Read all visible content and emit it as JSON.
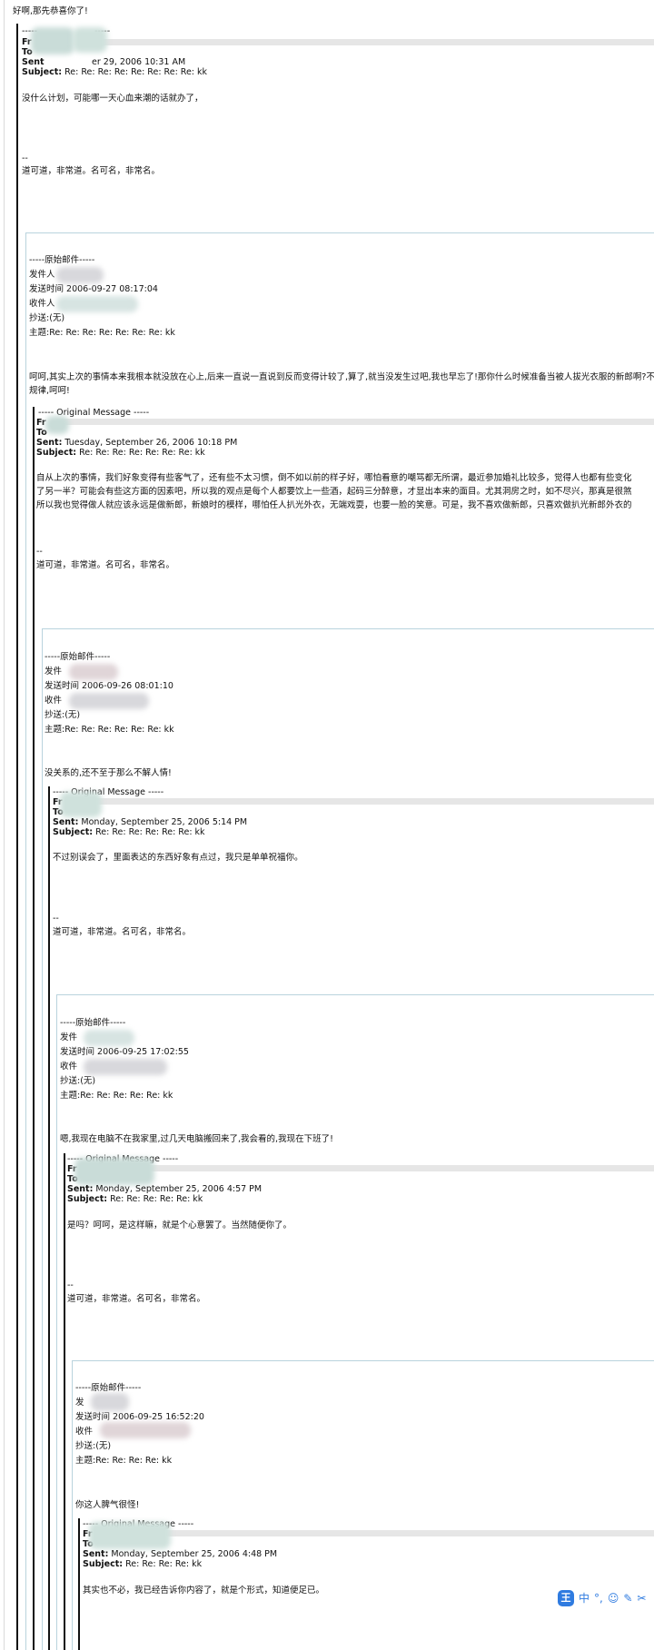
{
  "top_line": "好啊,那先恭喜你了!",
  "signature_dash": "--",
  "signature": "道可道，非常道。名可名，非常名。",
  "l0": {
    "dashes": "-----",
    "from": "Fr",
    "to": "To",
    "sent_label": "Sent",
    "sent_value": "er 29, 2006 10:31 AM",
    "subject_label": "Subject:",
    "subject_value": "Re: Re: Re: Re: Re: Re: Re: Re: kk",
    "body": "没什么计划，可能哪一天心血来潮的话就办了，"
  },
  "c1": {
    "header": "-----原始邮件-----",
    "sender": "发件人",
    "time": "发送时间 2006-09-27 08:17:04",
    "receiver": "收件人",
    "cc": "抄送:(无)",
    "subject": "主题:Re: Re: Re: Re: Re: Re: Re: kk",
    "body_line1": "呵呵,其实上次的事情本来我根本就没放在心上,后来一直说一直说到反而变得计较了,算了,就当没发生过吧,我也早忘了!那你什么时候准备当被人拔光衣服的新郎啊?不喜欢",
    "body_line2": "规律,呵呵!"
  },
  "l1": {
    "header": "----- Original Message -----",
    "from": "Fr",
    "to": "To",
    "sent_label": "Sent:",
    "sent_value": "Tuesday, September 26, 2006 10:18 PM",
    "subject_label": "Subject:",
    "subject_value": "Re: Re: Re: Re: Re: Re: Re: kk",
    "body_line1": "自从上次的事情，我们好象变得有些客气了，还有些不太习惯，倒不如以前的样子好，哪怕看意的嘲骂都无所谓，最近参加婚礼比较多，觉得人也都有些变化",
    "body_line2": "了另一半？可能会有些这方面的因素吧，所以我的观点是每个人都要饮上一些酒，起码三分醉意，才显出本来的面目。尤其洞房之时，如不尽兴，那真是很煞",
    "body_line3": "所以我也觉得做人就应该永远是做新郎，新娘时的模样，哪怕任人扒光外衣，无端戏耍，也要一脸的笑意。可是，我不喜欢做新郎，只喜欢做扒光新郎外衣的"
  },
  "c2": {
    "header": "-----原始邮件-----",
    "sender": "发件",
    "time": "发送时间 2006-09-26 08:01:10",
    "receiver": "收件",
    "cc": "抄送:(无)",
    "subject": "主题:Re: Re: Re: Re: Re: Re: kk",
    "body": "没关系的,还不至于那么不解人情!"
  },
  "l2": {
    "header": "----- Original Message -----",
    "from": "Fr",
    "to": "To",
    "sent_label": "Sent:",
    "sent_value": "Monday, September 25, 2006 5:14 PM",
    "subject_label": "Subject:",
    "subject_value": "Re: Re: Re: Re: Re: Re: kk",
    "body": "不过别误会了，里面表达的东西好象有点过，我只是单单祝福你。"
  },
  "c3": {
    "header": "-----原始邮件-----",
    "sender": "发件",
    "time": "发送时间 2006-09-25 17:02:55",
    "receiver": "收件",
    "cc": "抄送:(无)",
    "subject": "主题:Re: Re: Re: Re: Re: kk",
    "body": "嗯,我现在电脑不在我家里,过几天电脑搬回来了,我会看的,我现在下班了!"
  },
  "l3": {
    "header": "----- Original Message -----",
    "from": "Fr",
    "to": "To",
    "sent_label": "Sent:",
    "sent_value": "Monday, September 25, 2006 4:57 PM",
    "subject_label": "Subject:",
    "subject_value": "Re: Re: Re: Re: Re: kk",
    "body": "是吗？呵呵，是这样嘛，就是个心意罢了。当然随便你了。"
  },
  "c4": {
    "header": "-----原始邮件-----",
    "sender": "发",
    "time": "发送时间 2006-09-25 16:52:20",
    "receiver": "收件",
    "cc": "抄送:(无)",
    "subject": "主题:Re: Re: Re: Re: kk",
    "body": "你这人脾气很怪!"
  },
  "l4": {
    "header": "----- Original Message -----",
    "from": "Fr",
    "to": "To",
    "sent_label": "Sent:",
    "sent_value": "Monday, September 25, 2006 4:48 PM",
    "subject_label": "Subject:",
    "subject_value": "Re: Re: Re: Re: kk",
    "body": "其实也不必，我已经告诉你内容了，就是个形式，知道便足已。"
  },
  "ime_toolbar": {
    "logo": "王",
    "items": [
      "中",
      "°,",
      "☺",
      "✎",
      "✂"
    ],
    "accent_color": "#2f7be0"
  }
}
